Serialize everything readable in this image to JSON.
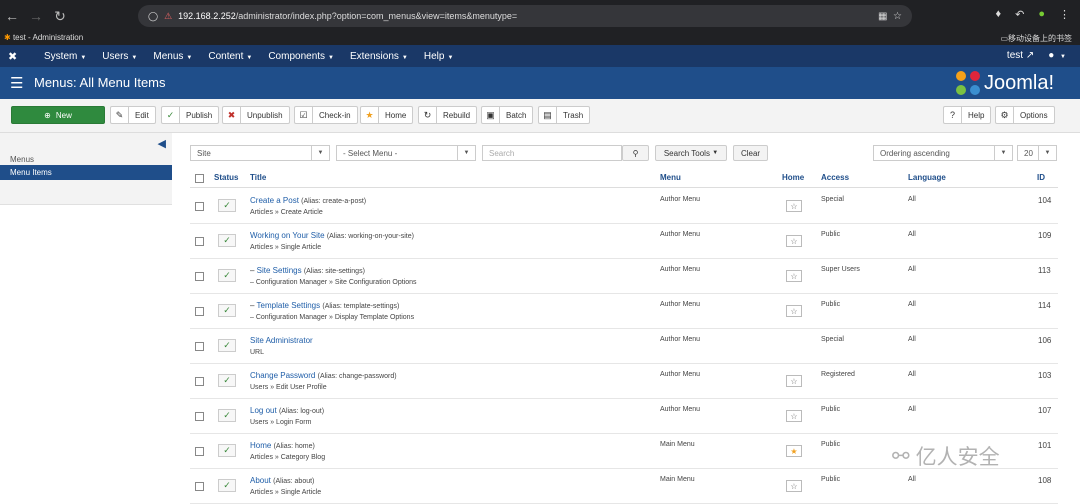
{
  "browser": {
    "url_host": "192.168.2.252",
    "url_path": "/administrator/index.php?option=com_menus&view=items&menutype=",
    "tab_title": "test - Administration",
    "bookmark": "移动设备上的书签"
  },
  "admin_nav": {
    "items": [
      "System",
      "Users",
      "Menus",
      "Content",
      "Components",
      "Extensions",
      "Help"
    ],
    "site_name": "test"
  },
  "page": {
    "title": "Menus: All Menu Items",
    "brand": "Joomla!"
  },
  "toolbar": {
    "new": "New",
    "edit": "Edit",
    "publish": "Publish",
    "unpublish": "Unpublish",
    "checkin": "Check-in",
    "home": "Home",
    "rebuild": "Rebuild",
    "batch": "Batch",
    "trash": "Trash",
    "help": "Help",
    "options": "Options"
  },
  "sidebar": {
    "heading": "Menus",
    "active_item": "Menu Items"
  },
  "filters": {
    "client": "Site",
    "menu": "- Select Menu -",
    "search_placeholder": "Search",
    "search_tools": "Search Tools",
    "clear": "Clear",
    "ordering": "Ordering ascending",
    "limit": "20"
  },
  "table": {
    "headers": {
      "status": "Status",
      "title": "Title",
      "menu": "Menu",
      "home": "Home",
      "access": "Access",
      "language": "Language",
      "id": "ID"
    },
    "rows": [
      {
        "prefix": "",
        "title": "Create a Post",
        "alias": "(Alias: create-a-post)",
        "sub": "Articles » Create Article",
        "menu": "Author Menu",
        "home": "off",
        "access": "Special",
        "language": "All",
        "id": "104"
      },
      {
        "prefix": "",
        "title": "Working on Your Site",
        "alias": "(Alias: working-on-your-site)",
        "sub": "Articles » Single Article",
        "menu": "Author Menu",
        "home": "off",
        "access": "Public",
        "language": "All",
        "id": "109"
      },
      {
        "prefix": "– ",
        "title": "Site Settings",
        "alias": "(Alias: site-settings)",
        "sub": "– Configuration Manager » Site Configuration Options",
        "menu": "Author Menu",
        "home": "off",
        "access": "Super Users",
        "language": "All",
        "id": "113"
      },
      {
        "prefix": "– ",
        "title": "Template Settings",
        "alias": "(Alias: template-settings)",
        "sub": "– Configuration Manager » Display Template Options",
        "menu": "Author Menu",
        "home": "off",
        "access": "Public",
        "language": "All",
        "id": "114"
      },
      {
        "prefix": "",
        "title": "Site Administrator",
        "alias": "",
        "sub": "URL",
        "menu": "Author Menu",
        "home": "none",
        "access": "Special",
        "language": "All",
        "id": "106"
      },
      {
        "prefix": "",
        "title": "Change Password",
        "alias": "(Alias: change-password)",
        "sub": "Users » Edit User Profile",
        "menu": "Author Menu",
        "home": "off",
        "access": "Registered",
        "language": "All",
        "id": "103"
      },
      {
        "prefix": "",
        "title": "Log out",
        "alias": "(Alias: log-out)",
        "sub": "Users » Login Form",
        "menu": "Author Menu",
        "home": "off",
        "access": "Public",
        "language": "All",
        "id": "107"
      },
      {
        "prefix": "",
        "title": "Home",
        "alias": "(Alias: home)",
        "sub": "Articles » Category Blog",
        "menu": "Main Menu",
        "home": "on",
        "access": "Public",
        "language": "",
        "id": "101"
      },
      {
        "prefix": "",
        "title": "About",
        "alias": "(Alias: about)",
        "sub": "Articles » Single Article",
        "menu": "Main Menu",
        "home": "off",
        "access": "Public",
        "language": "All",
        "id": "108"
      }
    ]
  },
  "watermark": "亿人安全",
  "colors": {
    "nav_bg": "#1a3867",
    "title_bg": "#1f4e8a",
    "new_btn": "#2f8a3e",
    "link": "#1f5ea8"
  }
}
